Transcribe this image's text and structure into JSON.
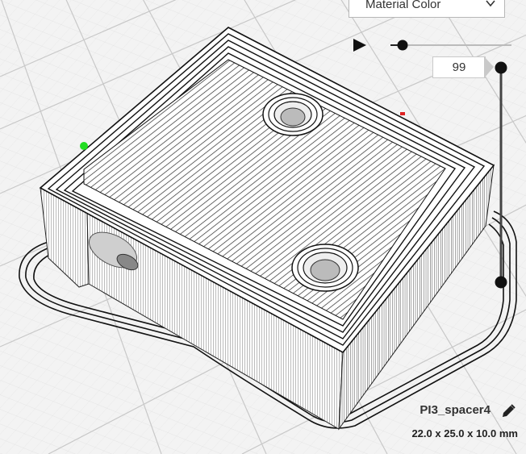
{
  "view": {
    "color_scheme_selected": "Material Color",
    "layer_number": "99",
    "icons": {
      "play": "play-icon",
      "edit": "pencil-icon",
      "dropdown": "chevron-down-icon"
    }
  },
  "object": {
    "name": "PI3_spacer4",
    "dimensions": "22.0 x 25.0 x 10.0 mm"
  },
  "simulation": {
    "progress_fraction": 0.1
  },
  "layer_view": {
    "current_layer_fraction": 1.0
  },
  "colors": {
    "background": "#f3f3f3",
    "model_white": "#ffffff",
    "line_dark": "#222222",
    "start_marker": "#22dd22",
    "seam_marker": "#dd2222"
  }
}
